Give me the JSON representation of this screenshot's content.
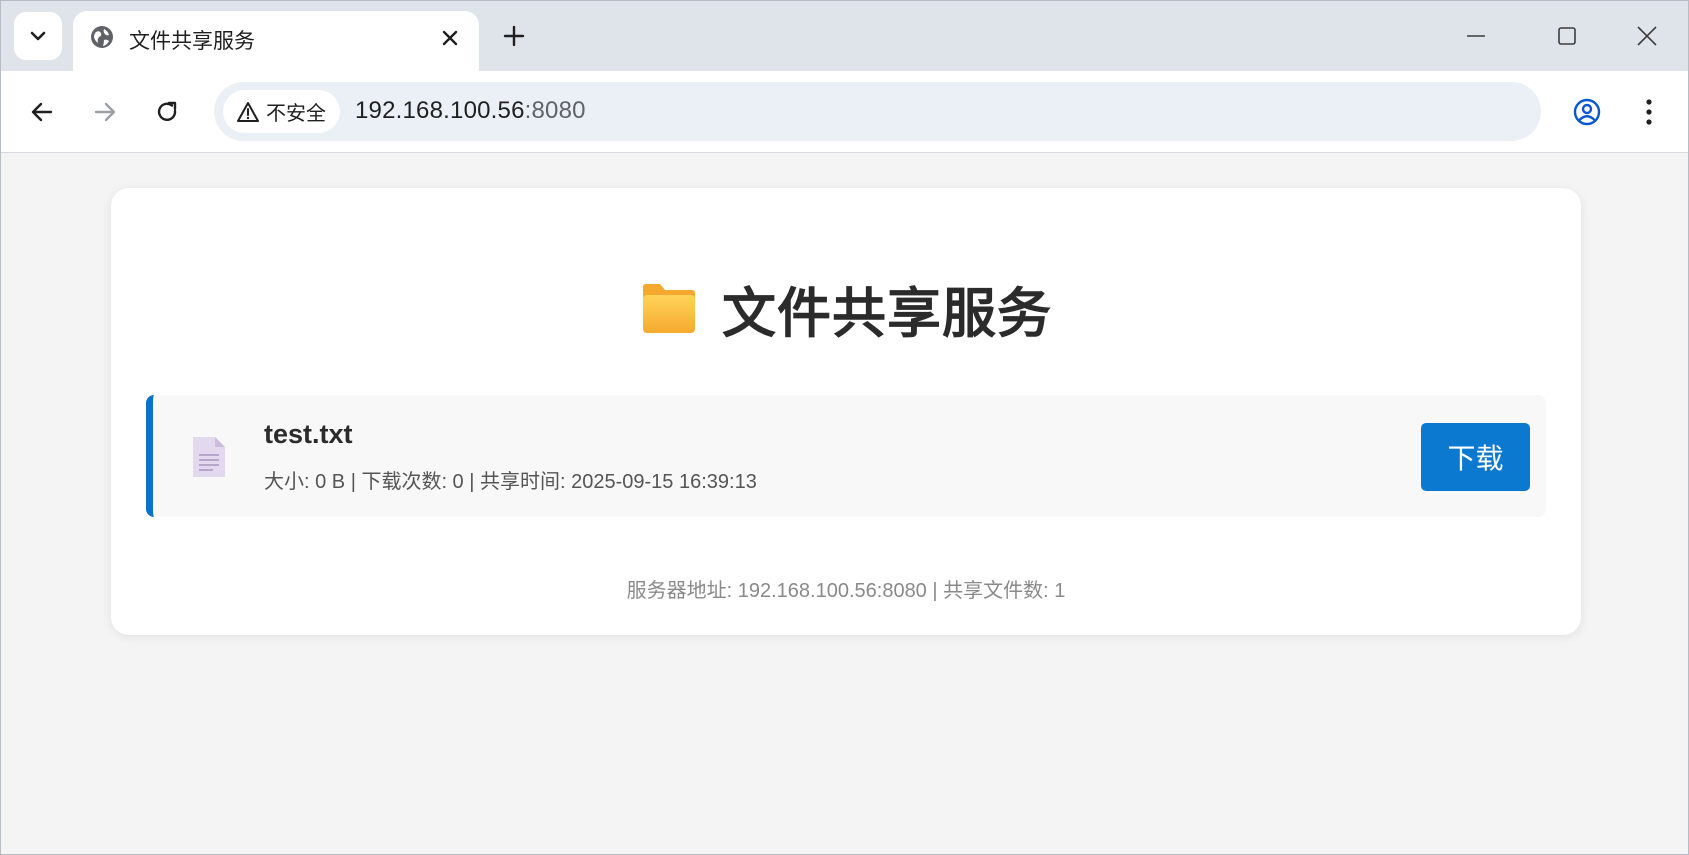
{
  "browser": {
    "tab_title": "文件共享服务",
    "security_label": "不安全",
    "url_host": "192.168.100.56",
    "url_port": ":8080",
    "icons": {
      "tab_search": "chevron-down-icon",
      "tab_favicon": "globe-icon",
      "tab_close": "close-icon",
      "new_tab": "plus-icon",
      "minimize": "minimize-icon",
      "maximize": "maximize-icon",
      "close_window": "close-icon",
      "back": "arrow-left-icon",
      "forward": "arrow-right-icon",
      "reload": "reload-icon",
      "warning": "warning-icon",
      "bookmark": "star-icon",
      "profile": "profile-icon",
      "menu": "kebab-menu-icon"
    }
  },
  "page": {
    "title": "文件共享服务",
    "files": [
      {
        "name": "test.txt",
        "meta": "大小: 0 B | 下载次数: 0 | 共享时间: 2025-09-15 16:39:13",
        "action_label": "下载"
      }
    ],
    "footer": "服务器地址: 192.168.100.56:8080 | 共享文件数: 1"
  },
  "colors": {
    "accent": "#0b79d0",
    "row_border": "#0d73c8",
    "folder": "#f9c440"
  }
}
